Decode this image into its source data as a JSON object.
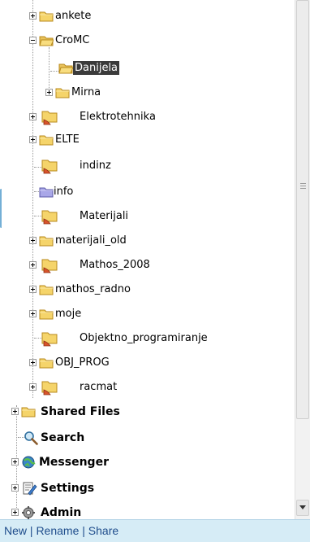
{
  "tree": {
    "items": [
      {
        "label": "ankete",
        "icon": "folder-icon",
        "expander": "plus"
      },
      {
        "label": "CroMC",
        "icon": "folder-open-icon",
        "expander": "minus"
      },
      {
        "label": "Danijela",
        "icon": "folder-open-icon",
        "expander": "none",
        "selected": true
      },
      {
        "label": "Mirna",
        "icon": "folder-icon",
        "expander": "plus"
      },
      {
        "label": "Elektrotehnika",
        "icon": "shared-folder-icon",
        "expander": "plus"
      },
      {
        "label": "ELTE",
        "icon": "folder-icon",
        "expander": "plus"
      },
      {
        "label": "indinz",
        "icon": "shared-folder-icon",
        "expander": "none"
      },
      {
        "label": "info",
        "icon": "folder-icon-purple",
        "expander": "none"
      },
      {
        "label": "Materijali",
        "icon": "shared-folder-icon",
        "expander": "none"
      },
      {
        "label": "materijali_old",
        "icon": "folder-icon",
        "expander": "plus"
      },
      {
        "label": "Mathos_2008",
        "icon": "shared-folder-icon",
        "expander": "plus"
      },
      {
        "label": "mathos_radno",
        "icon": "folder-icon",
        "expander": "plus"
      },
      {
        "label": "moje",
        "icon": "folder-icon",
        "expander": "plus"
      },
      {
        "label": "Objektno_programiranje",
        "icon": "shared-folder-icon",
        "expander": "none"
      },
      {
        "label": "OBJ_PROG",
        "icon": "folder-icon",
        "expander": "plus"
      },
      {
        "label": "racmat",
        "icon": "shared-folder-icon",
        "expander": "plus"
      },
      {
        "label": "Shared Files",
        "icon": "folder-icon",
        "expander": "plus"
      },
      {
        "label": "Search",
        "icon": "magnifier-icon",
        "expander": "none"
      },
      {
        "label": "Messenger",
        "icon": "messenger-icon",
        "expander": "plus"
      },
      {
        "label": "Settings",
        "icon": "settings-icon",
        "expander": "plus"
      },
      {
        "label": "Admin",
        "icon": "admin-icon",
        "expander": "plus"
      }
    ]
  },
  "bottombar": {
    "new_label": "New",
    "rename_label": "Rename",
    "share_label": "Share",
    "separator": " | "
  },
  "colors": {
    "folder": "#f5d46a",
    "selection": "#3b3b3b",
    "bottombar_bg": "#d6ecf6",
    "link": "#1f4d8c"
  }
}
